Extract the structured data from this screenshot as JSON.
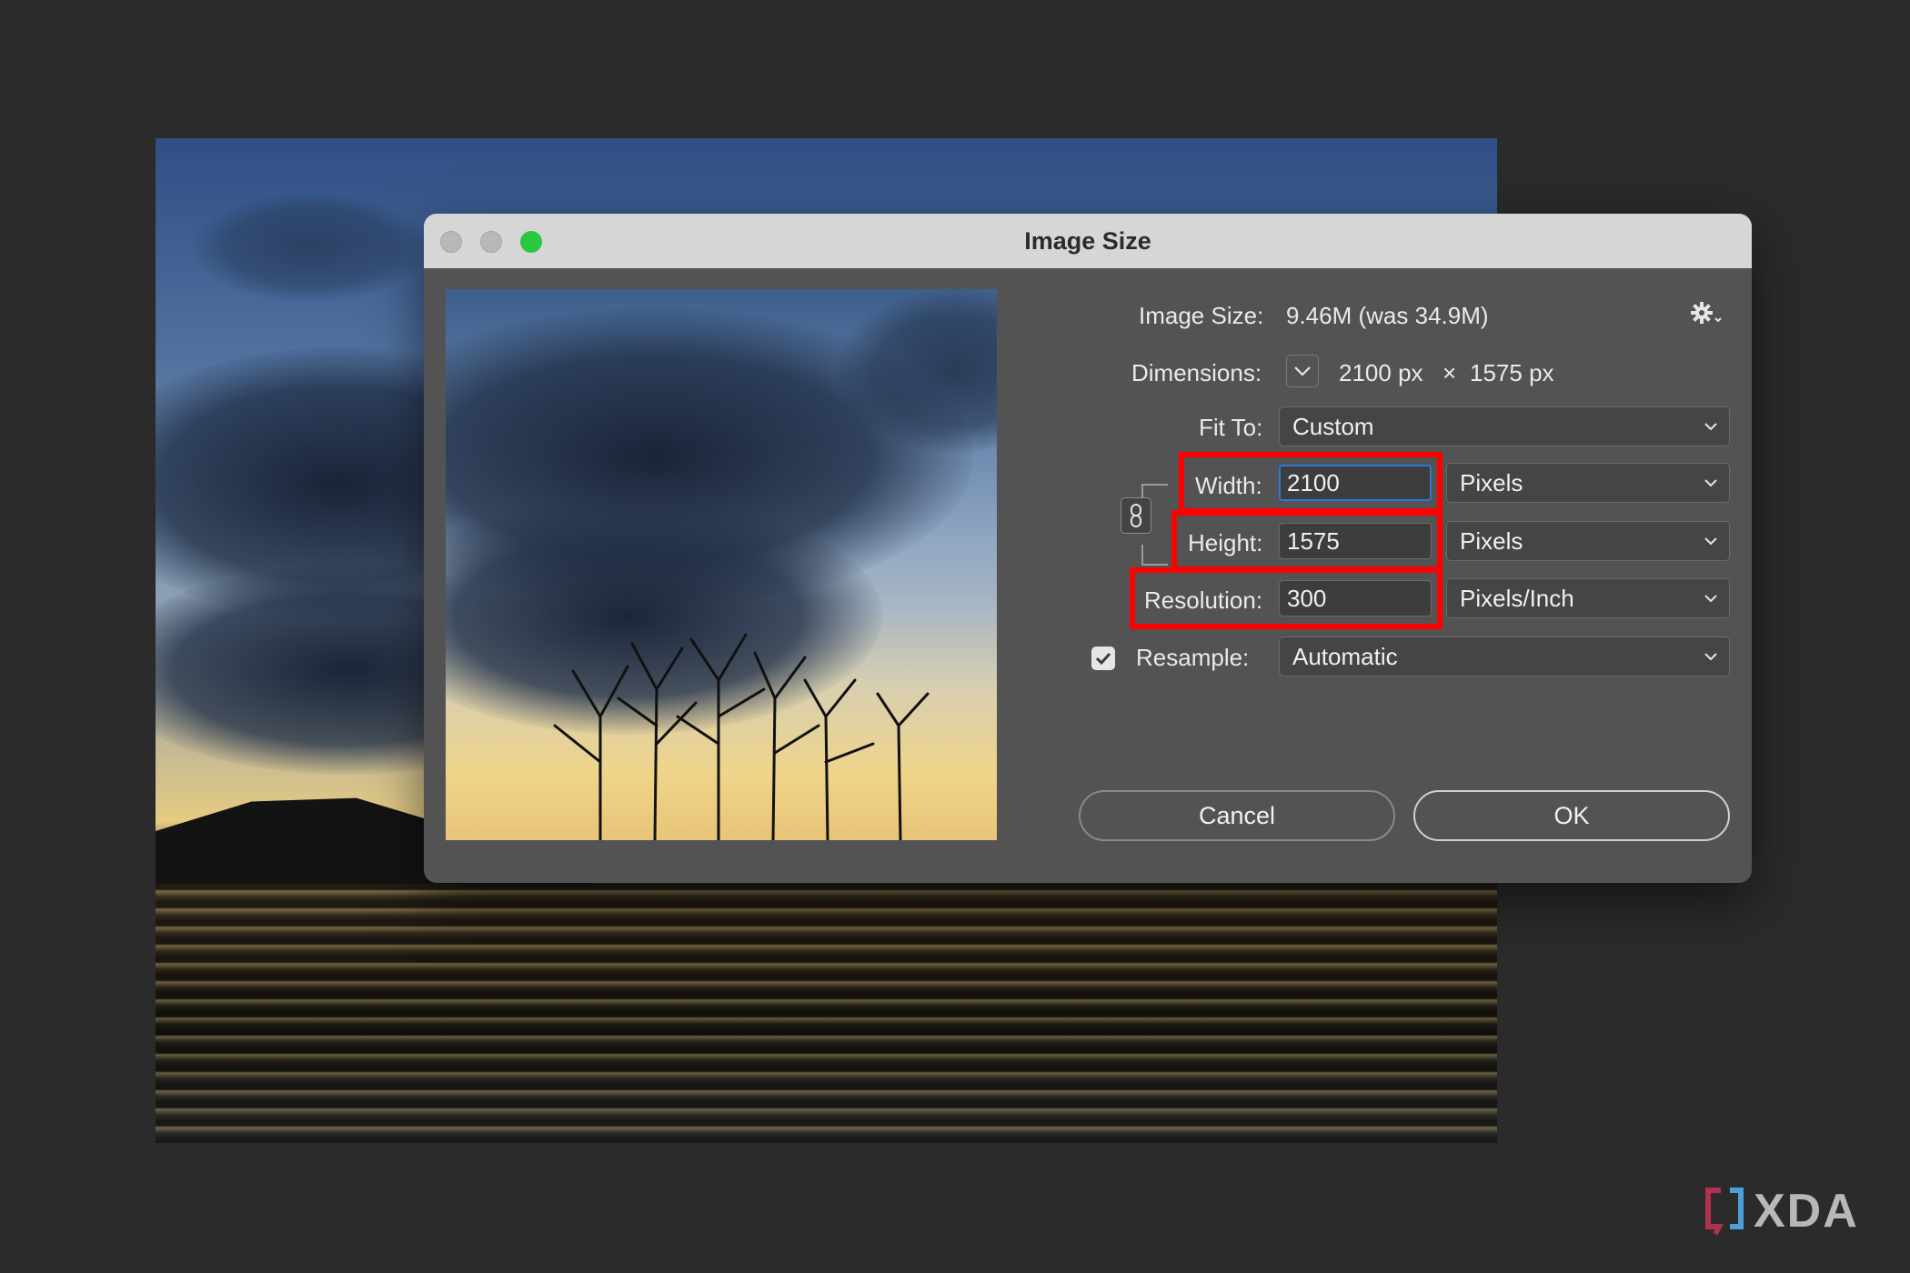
{
  "dialog": {
    "title": "Image Size",
    "image_size_label": "Image Size:",
    "image_size_value": "9.46M (was 34.9M)",
    "dimensions_label": "Dimensions:",
    "dimensions_width": "2100 px",
    "dimensions_times": "×",
    "dimensions_height": "1575 px",
    "fit_to_label": "Fit To:",
    "fit_to_value": "Custom",
    "width_label": "Width:",
    "width_value": "2100",
    "width_unit": "Pixels",
    "height_label": "Height:",
    "height_value": "1575",
    "height_unit": "Pixels",
    "resolution_label": "Resolution:",
    "resolution_value": "300",
    "resolution_unit": "Pixels/Inch",
    "resample_label": "Resample:",
    "resample_value": "Automatic",
    "resample_checked": true,
    "cancel_label": "Cancel",
    "ok_label": "OK"
  },
  "icons": {
    "settings": "gear-icon",
    "constrain": "chain-link-icon",
    "dropdown": "chevron-down-icon"
  },
  "colors": {
    "highlight": "#ff0000",
    "focus": "#2f77d8",
    "zoom_button": "#2ac840"
  },
  "watermark": "XDA"
}
